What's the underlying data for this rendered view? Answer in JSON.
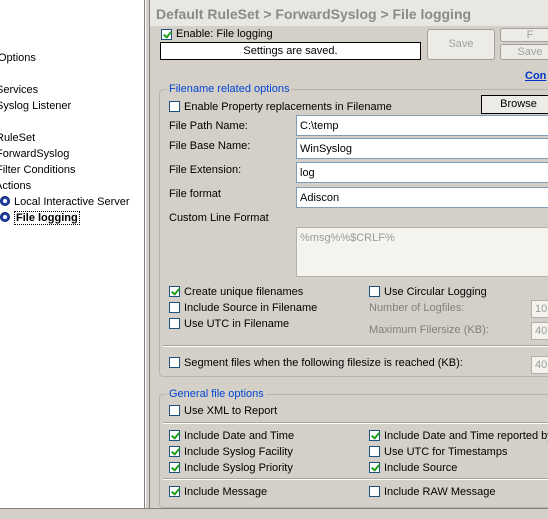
{
  "breadcrumb": "Default RuleSet > ForwardSyslog > File logging",
  "tree": {
    "items": [
      {
        "label": "Options",
        "id": "options"
      },
      {
        "label": "Services",
        "id": "services"
      },
      {
        "label": "Syslog Listener",
        "id": "syslog-listener"
      },
      {
        "label": "RuleSet",
        "id": "ruleset"
      },
      {
        "label": "ForwardSyslog",
        "id": "forwardsyslog"
      },
      {
        "label": "Filter Conditions",
        "id": "filter-conditions"
      },
      {
        "label": "Actions",
        "id": "actions"
      },
      {
        "label": "Local Interactive Server",
        "id": "local-interactive-server"
      },
      {
        "label": "File logging",
        "id": "file-logging"
      }
    ]
  },
  "header": {
    "enable_label": "Enable: File logging",
    "enable_checked": true,
    "status": "Settings are saved.",
    "save_label": "Save",
    "button2_label": "F",
    "button3_label": "Save",
    "link_label": "Con"
  },
  "filename_options": {
    "title": "Filename related options",
    "property_replacements_label": "Enable Property replacements in Filename",
    "property_replacements_checked": false,
    "browse_label": "Browse",
    "file_path_label": "File Path Name:",
    "file_path_value": "C:\\temp",
    "file_base_label": "File Base Name:",
    "file_base_value": "WinSyslog",
    "file_ext_label": "File Extension:",
    "file_ext_value": "log",
    "file_format_label": "File format",
    "file_format_value": "Adiscon",
    "custom_line_label": "Custom Line Format",
    "custom_line_value": "%msg%%$CRLF%",
    "create_unique_label": "Create unique filenames",
    "create_unique_checked": true,
    "include_source_label": "Include Source in Filename",
    "include_source_checked": false,
    "use_utc_label": "Use UTC in Filename",
    "use_utc_checked": false,
    "circular_label": "Use Circular Logging",
    "circular_checked": false,
    "num_logfiles_label": "Number of Logfiles:",
    "num_logfiles_value": "10",
    "max_filesize_label": "Maximum Filersize (KB):",
    "max_filesize_value": "40",
    "segment_label": "Segment files when the following filesize is reached (KB):",
    "segment_checked": false,
    "segment_value": "40"
  },
  "general_options": {
    "title": "General file options",
    "use_xml_label": "Use XML to Report",
    "use_xml_checked": false,
    "date_time_label": "Include Date and Time",
    "date_time_checked": true,
    "date_time_reported_label": "Include Date and Time reported by",
    "date_time_reported_checked": true,
    "facility_label": "Include Syslog Facility",
    "facility_checked": true,
    "utc_timestamps_label": "Use UTC for Timestamps",
    "utc_timestamps_checked": false,
    "priority_label": "Include Syslog Priority",
    "priority_checked": true,
    "include_source_label": "Include Source",
    "include_source_checked": true,
    "message_label": "Include Message",
    "message_checked": true,
    "raw_message_label": "Include RAW Message",
    "raw_message_checked": false
  }
}
